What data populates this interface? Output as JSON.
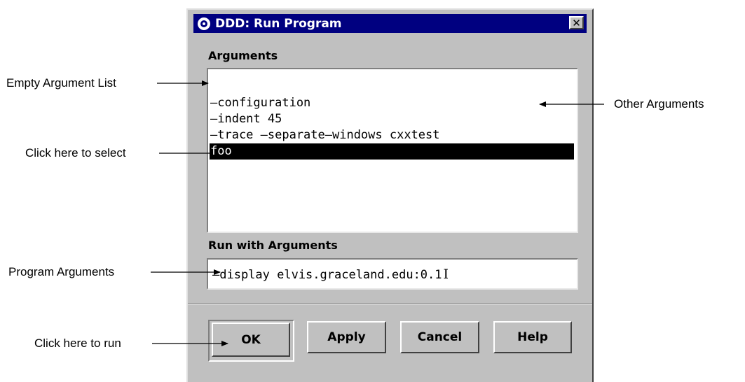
{
  "dialog": {
    "title": "DDD: Run Program",
    "close_symbol": "✕",
    "arguments_label": "Arguments",
    "arguments_list": [
      "",
      "—configuration",
      "—indent 45",
      "—trace —separate—windows cxxtest",
      "foo"
    ],
    "selected_index": 4,
    "run_with_label": "Run with Arguments",
    "run_with_value": "—display elvis.graceland.edu:0.1",
    "ibeam": "I",
    "buttons": {
      "ok": "OK",
      "apply": "Apply",
      "cancel": "Cancel",
      "help": "Help"
    }
  },
  "annotations": {
    "empty_argument_list": "Empty Argument List",
    "click_to_select": "Click here to select",
    "program_arguments": "Program Arguments",
    "click_to_run": "Click here to run",
    "other_arguments": "Other Arguments"
  },
  "icons": {
    "app": "ddd-app-icon",
    "close": "close-icon",
    "cursor": "ibeam-cursor-icon"
  },
  "colors": {
    "titlebar": "#000080",
    "dialog_bg": "#c0c0c0",
    "selection": "#000000"
  }
}
